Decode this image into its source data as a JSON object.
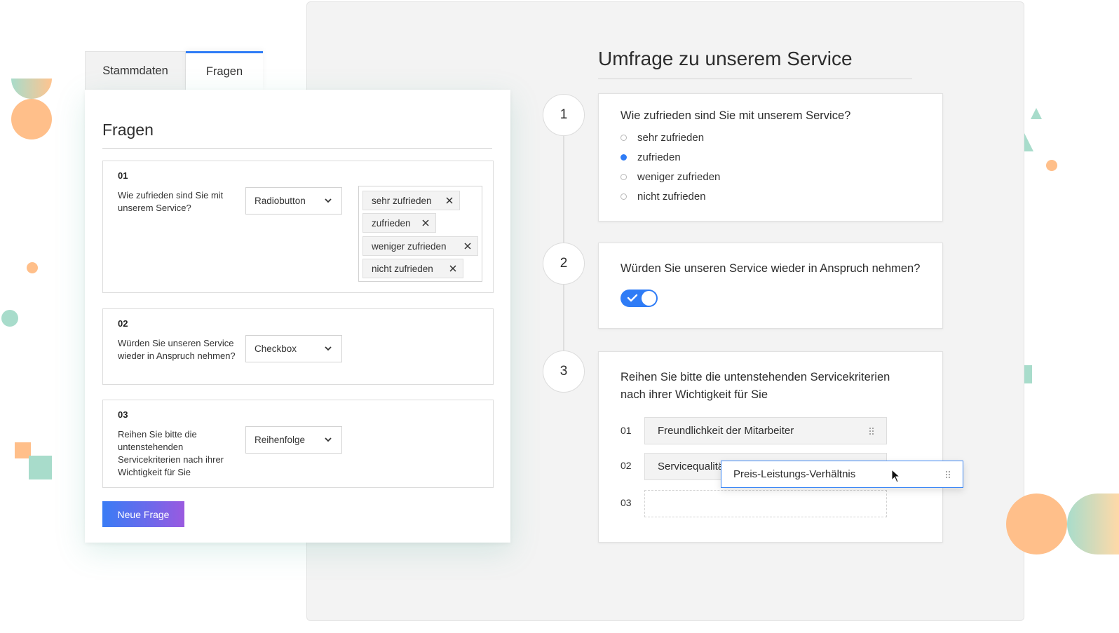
{
  "editor": {
    "tabs": [
      {
        "label": "Stammdaten"
      },
      {
        "label": "Fragen"
      }
    ],
    "title": "Fragen",
    "questions": [
      {
        "number": "01",
        "text": "Wie zufrieden sind Sie mit unserem Service?",
        "type": "Radiobutton",
        "options": [
          "sehr zufrieden",
          "zufrieden",
          "weniger zufrieden",
          "nicht zufrieden"
        ]
      },
      {
        "number": "02",
        "text": "Würden Sie unseren Service wieder in Anspruch nehmen?",
        "type": "Checkbox"
      },
      {
        "number": "03",
        "text": "Reihen Sie bitte die untenstehenden Servicekriterien nach ihrer Wichtigkeit für Sie",
        "type": "Reihenfolge"
      }
    ],
    "new_question_label": "Neue Frage"
  },
  "preview": {
    "title": "Umfrage zu unserem Service",
    "steps": [
      "1",
      "2",
      "3"
    ],
    "q1": {
      "title": "Wie zufrieden sind Sie mit unserem Service?",
      "options": [
        "sehr zufrieden",
        "zufrieden",
        "weniger zufrieden",
        "nicht zufrieden"
      ],
      "selected_index": 1
    },
    "q2": {
      "title": "Würden Sie unseren Service wieder in Anspruch nehmen?",
      "toggle_on": true
    },
    "q3": {
      "title_line1": "Reihen Sie bitte die untenstehenden Servicekriterien",
      "title_line2": "nach ihrer Wichtigkeit für Sie",
      "ranks": [
        "01",
        "02",
        "03"
      ],
      "items": [
        "Freundlichkeit der Mitarbeiter",
        "Servicequalität"
      ],
      "dragging_item": "Preis-Leistungs-Verhältnis"
    }
  },
  "colors": {
    "accent": "#2f7cf6",
    "deco_orange": "#ffbf8a",
    "deco_mint": "#a8dccb"
  }
}
